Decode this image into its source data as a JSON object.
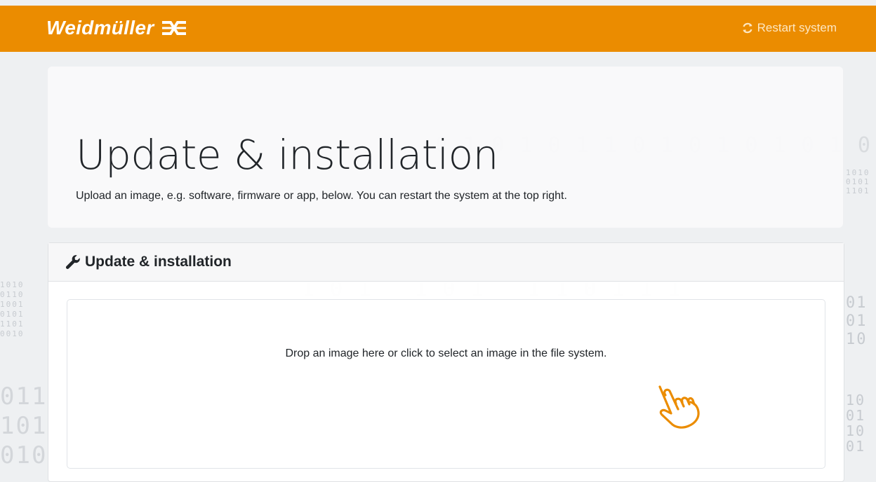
{
  "header": {
    "brand": "Weidmüller",
    "restart_label": "Restart system",
    "accent_color": "#eb8c00"
  },
  "jumbotron": {
    "title": "Update & installation",
    "subtitle": "Upload an image, e.g. software, firmware or app, below. You can restart the system at the top right."
  },
  "card": {
    "title": "Update & installation",
    "icon": "wrench-icon",
    "dropzone": {
      "message": "Drop an image here or click to select an image in the file system.",
      "icon": "pointing-hand-icon"
    }
  }
}
